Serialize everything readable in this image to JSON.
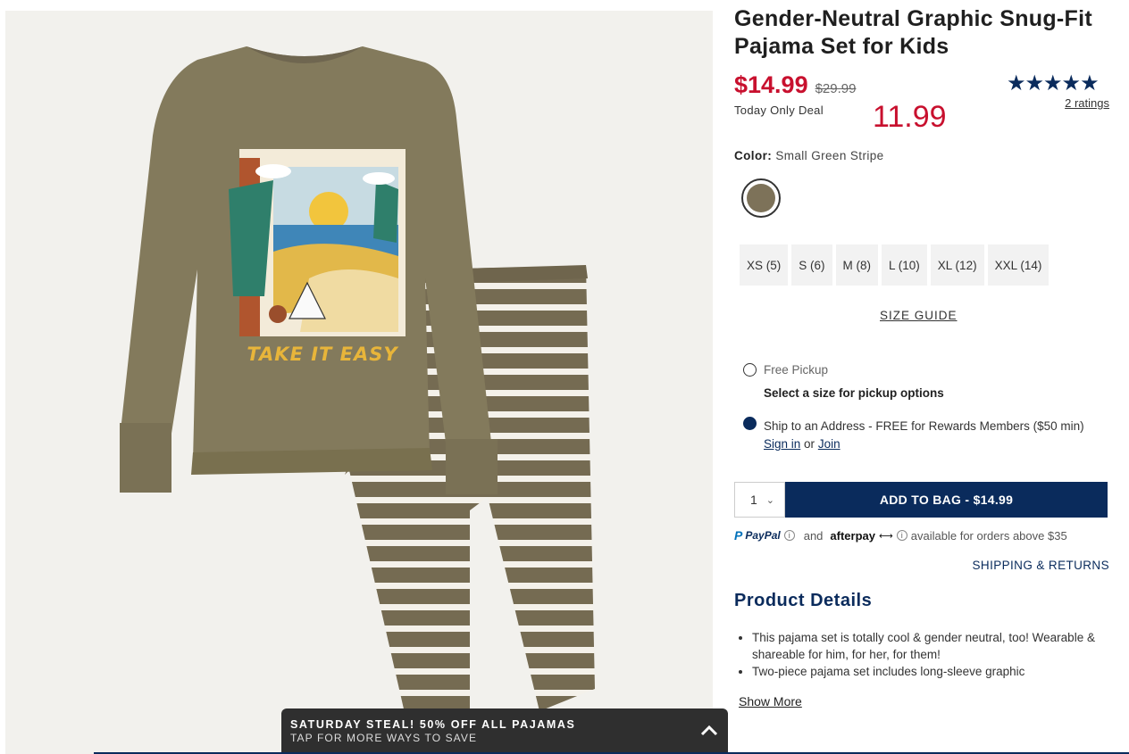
{
  "product": {
    "title": "Gender-Neutral Graphic Snug-Fit Pajama Set for Kids",
    "price_now": "$14.99",
    "price_was": "$29.99",
    "deal_label": "Today Only Deal",
    "annotated_price": "11.99",
    "stars": "★★★★★",
    "ratings_link": "2 ratings",
    "shirt_graphic_text": "TAKE IT EASY"
  },
  "color": {
    "label": "Color:",
    "value": "Small Green Stripe",
    "swatch_hex": "#7d7259"
  },
  "sizes": [
    "XS (5)",
    "S (6)",
    "M (8)",
    "L (10)",
    "XL (12)",
    "XXL (14)"
  ],
  "size_guide": "SIZE GUIDE",
  "fulfillment": {
    "pickup_label": "Free Pickup",
    "pickup_sub": "Select a size for pickup options",
    "ship_label": "Ship to an Address - FREE for Rewards Members ($50 min)",
    "sign_in": "Sign in",
    "or": "or",
    "join": "Join",
    "selected": "ship"
  },
  "cart": {
    "quantity": "1",
    "add_button": "ADD TO BAG  -  $14.99"
  },
  "payments": {
    "paypal": "PayPal",
    "and": "and",
    "afterpay": "afterpay",
    "note": "available for orders above $35"
  },
  "shipping_returns": "SHIPPING & RETURNS",
  "details": {
    "heading": "Product Details",
    "bullets": [
      "This pajama set is totally cool & gender neutral, too! Wearable & shareable for him, for her, for them!",
      "Two-piece pajama set includes long-sleeve graphic"
    ],
    "show_more": "Show More"
  },
  "promo": {
    "title": "SATURDAY STEAL! 50% OFF ALL PAJAMAS",
    "subtitle": "TAP FOR MORE WAYS TO SAVE"
  },
  "colors": {
    "accent_navy": "#0a2b5c",
    "sale_red": "#c8102e",
    "garment_olive": "#7d7259"
  }
}
